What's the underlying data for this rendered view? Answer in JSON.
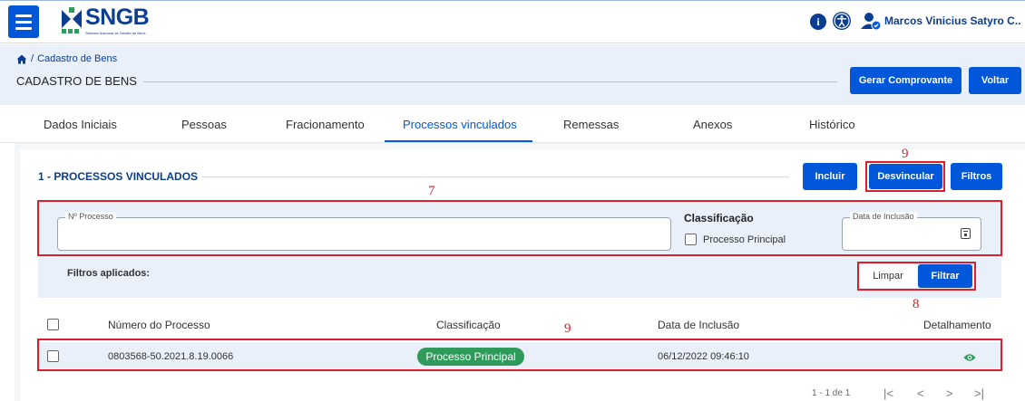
{
  "header": {
    "logo_text": "SNGB",
    "logo_subtitle": "Sistema Nacional de Gestão de Bens",
    "user_name": "Marcos Vinicius Satyro C.."
  },
  "breadcrumb": {
    "home_icon": "home-icon",
    "separator": "/",
    "current": "Cadastro de Bens"
  },
  "page": {
    "title": "CADASTRO DE BENS",
    "btn_gerar": "Gerar Comprovante",
    "btn_voltar": "Voltar"
  },
  "tabs": [
    {
      "label": "Dados Iniciais",
      "active": false
    },
    {
      "label": "Pessoas",
      "active": false
    },
    {
      "label": "Fracionamento",
      "active": false
    },
    {
      "label": "Processos vinculados",
      "active": true
    },
    {
      "label": "Remessas",
      "active": false
    },
    {
      "label": "Anexos",
      "active": false
    },
    {
      "label": "Histórico",
      "active": false
    }
  ],
  "section": {
    "title": "1 - PROCESSOS VINCULADOS",
    "btn_incluir": "Incluir",
    "btn_desvincular": "Desvincular",
    "btn_filtros": "Filtros"
  },
  "filters": {
    "processo_label": "Nº Processo",
    "processo_value": "",
    "classificacao_label": "Classificação",
    "principal_label": "Processo Principal",
    "principal_checked": false,
    "data_label": "Data de Inclusão",
    "data_value": ""
  },
  "applied": {
    "label": "Filtros aplicados:",
    "btn_limpar": "Limpar",
    "btn_filtrar": "Filtrar"
  },
  "table": {
    "columns": [
      "Número do Processo",
      "Classificação",
      "Data de Inclusão",
      "Detalhamento"
    ],
    "rows": [
      {
        "numero": "0803568-50.2021.8.19.0066",
        "classificacao": "Processo Principal",
        "data": "06/12/2022 09:46:10",
        "detalhamento_icon": "eye-icon"
      }
    ]
  },
  "pagination": {
    "info": "1 - 1 de 1"
  },
  "annotations": [
    "9",
    "7",
    "8",
    "9"
  ],
  "colors": {
    "primary": "#0057d9",
    "navy": "#0b3d91",
    "success": "#2e9b5a",
    "annotation_red": "#e01e2b"
  }
}
